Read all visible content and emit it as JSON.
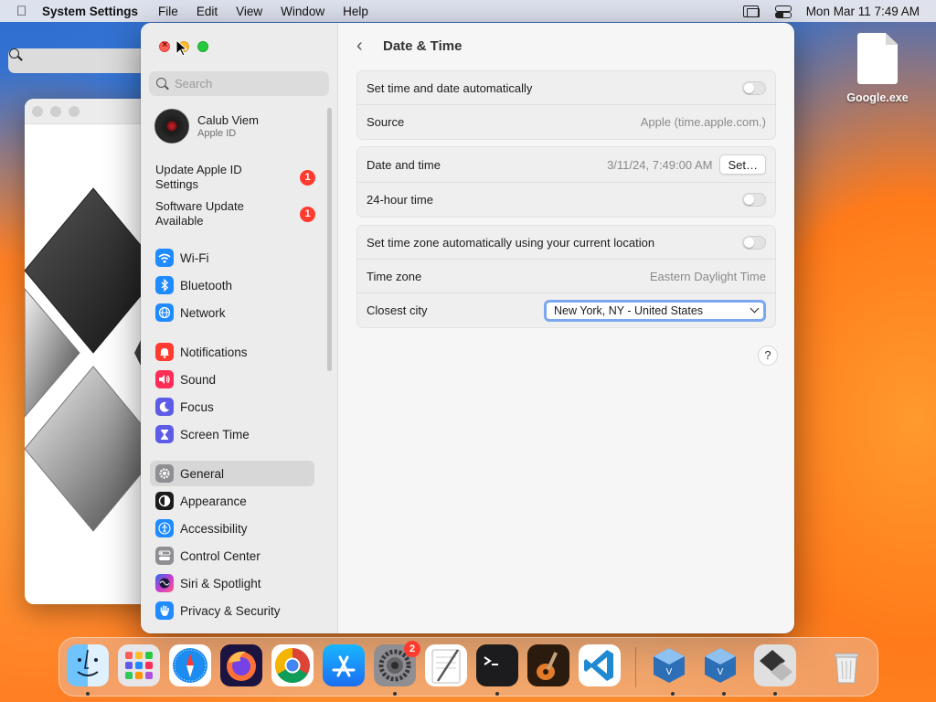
{
  "menubar": {
    "app_name": "System Settings",
    "menus": [
      "File",
      "Edit",
      "View",
      "Window",
      "Help"
    ],
    "clock": "Mon Mar 11  7:49 AM"
  },
  "desktop": {
    "file_label": "Google.exe"
  },
  "sidebar": {
    "search_placeholder": "Search",
    "profile": {
      "name": "Calub Viem",
      "subtitle": "Apple ID"
    },
    "notices": [
      {
        "label": "Update Apple ID Settings",
        "badge": "1"
      },
      {
        "label": "Software Update Available",
        "badge": "1"
      }
    ],
    "items": [
      {
        "label": "Wi-Fi",
        "icon": "wifi-icon",
        "color": "#1f8bff"
      },
      {
        "label": "Bluetooth",
        "icon": "bluetooth-icon",
        "color": "#1f8bff"
      },
      {
        "label": "Network",
        "icon": "globe-icon",
        "color": "#1f8bff"
      },
      {
        "label": "Notifications",
        "icon": "bell-icon",
        "color": "#ff3b30"
      },
      {
        "label": "Sound",
        "icon": "speaker-icon",
        "color": "#ff2d55"
      },
      {
        "label": "Focus",
        "icon": "moon-icon",
        "color": "#5e5ce6"
      },
      {
        "label": "Screen Time",
        "icon": "hourglass-icon",
        "color": "#5e5ce6"
      },
      {
        "label": "General",
        "icon": "gear-icon",
        "color": "#8e8e93"
      },
      {
        "label": "Appearance",
        "icon": "appearance-icon",
        "color": "#1c1c1e"
      },
      {
        "label": "Accessibility",
        "icon": "accessibility-icon",
        "color": "#1f8bff"
      },
      {
        "label": "Control Center",
        "icon": "control-center-icon",
        "color": "#8e8e93"
      },
      {
        "label": "Siri & Spotlight",
        "icon": "siri-icon",
        "color": "#a14be0"
      },
      {
        "label": "Privacy & Security",
        "icon": "hand-icon",
        "color": "#1f8bff"
      }
    ],
    "selected": "General"
  },
  "main": {
    "title": "Date & Time",
    "group1": {
      "auto_label": "Set time and date automatically",
      "auto_enabled": false,
      "source_label": "Source",
      "source_value": "Apple (time.apple.com.)"
    },
    "group2": {
      "datetime_label": "Date and time",
      "datetime_value": "3/11/24, 7:49:00 AM",
      "set_button": "Set…",
      "h24_label": "24-hour time",
      "h24_enabled": false
    },
    "group3": {
      "tz_auto_label": "Set time zone automatically using your current location",
      "tz_auto_enabled": false,
      "tz_label": "Time zone",
      "tz_value": "Eastern Daylight Time",
      "city_label": "Closest city",
      "city_value": "New York, NY - United States"
    },
    "help": "?"
  },
  "dock": {
    "apps": [
      "finder",
      "launchpad",
      "safari",
      "firefox",
      "chrome",
      "app-store",
      "system-settings",
      "textedit",
      "terminal",
      "garageband",
      "vscode",
      "virtualbox",
      "virtualbox",
      "boot-camp",
      "trash"
    ],
    "settings_badge": "2"
  }
}
